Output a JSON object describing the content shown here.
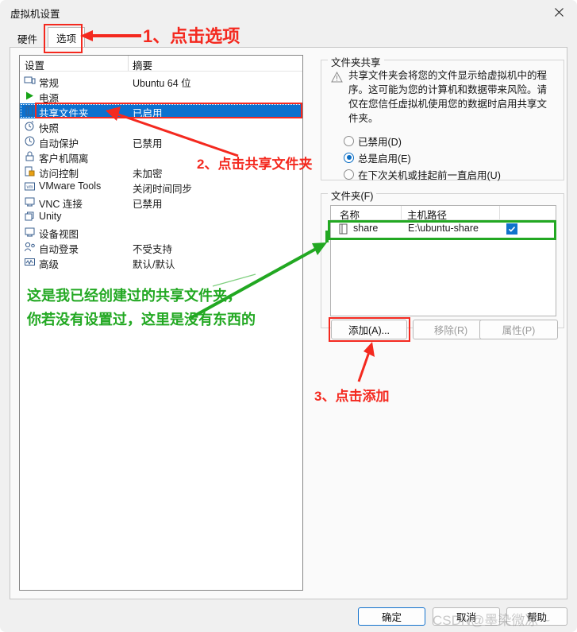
{
  "window": {
    "title": "虚拟机设置",
    "close_icon": "close-icon"
  },
  "tabs": [
    {
      "label": "硬件",
      "active": false
    },
    {
      "label": "选项",
      "active": true
    }
  ],
  "settings_list": {
    "headers": {
      "name": "设置",
      "summary": "摘要"
    },
    "rows": [
      {
        "icon": "monitor-icon",
        "label": "常规",
        "summary": "Ubuntu 64 位",
        "selected": false
      },
      {
        "icon": "power-play-icon",
        "label": "电源",
        "summary": "",
        "selected": false
      },
      {
        "icon": "folder-icon",
        "label": "共享文件夹",
        "summary": "已启用",
        "selected": true
      },
      {
        "icon": "snapshot-clock-icon",
        "label": "快照",
        "summary": "",
        "selected": false
      },
      {
        "icon": "clock-icon",
        "label": "自动保护",
        "summary": "已禁用",
        "selected": false
      },
      {
        "icon": "lock-icon",
        "label": "客户机隔离",
        "summary": "",
        "selected": false
      },
      {
        "icon": "access-lock-icon",
        "label": "访问控制",
        "summary": "未加密",
        "selected": false
      },
      {
        "icon": "vm-tools-icon",
        "label": "VMware Tools",
        "summary": "关闭时间同步",
        "selected": false
      },
      {
        "icon": "vnc-icon",
        "label": "VNC 连接",
        "summary": "已禁用",
        "selected": false
      },
      {
        "icon": "unity-icon",
        "label": "Unity",
        "summary": "",
        "selected": false
      },
      {
        "icon": "device-view-icon",
        "label": "设备视图",
        "summary": "",
        "selected": false
      },
      {
        "icon": "auto-login-icon",
        "label": "自动登录",
        "summary": "不受支持",
        "selected": false
      },
      {
        "icon": "advanced-icon",
        "label": "高级",
        "summary": "默认/默认",
        "selected": false
      }
    ]
  },
  "folder_sharing": {
    "legend": "文件夹共享",
    "warning_icon": "warning-triangle-icon",
    "warning_text": "共享文件夹会将您的文件显示给虚拟机中的程序。这可能为您的计算机和数据带来风险。请仅在您信任虚拟机使用您的数据时启用共享文件夹。",
    "options": [
      {
        "label": "已禁用(D)",
        "selected": false
      },
      {
        "label": "总是启用(E)",
        "selected": true
      },
      {
        "label": "在下次关机或挂起前一直启用(U)",
        "selected": false
      }
    ]
  },
  "folders": {
    "legend": "文件夹(F)",
    "columns": [
      "名称",
      "主机路径",
      ""
    ],
    "rows": [
      {
        "icon": "folder-small-icon",
        "name": "share",
        "path": "E:\\ubuntu-share",
        "enabled": true,
        "check_icon": "check-icon"
      }
    ],
    "buttons": [
      {
        "label": "添加(A)...",
        "enabled": true
      },
      {
        "label": "移除(R)",
        "enabled": false
      },
      {
        "label": "属性(P)",
        "enabled": false
      }
    ]
  },
  "dialog_buttons": [
    {
      "label": "确定",
      "default": true
    },
    {
      "label": "取消",
      "default": false
    },
    {
      "label": "帮助",
      "default": false
    }
  ],
  "watermark": "CSDN@墨染微凉 ~",
  "annotations": {
    "step1": "1、点击选项",
    "step2": "2、点击共享文件夹",
    "step3": "3、点击添加",
    "green_note": "这是我已经创建过的共享文件夹，\n你若没有设置过，这里是没有东西的"
  },
  "colors": {
    "annotation_red": "#f4291f",
    "annotation_green": "#22a822",
    "selection_blue": "#0b71cf",
    "checkbox_blue": "#1073cb"
  }
}
